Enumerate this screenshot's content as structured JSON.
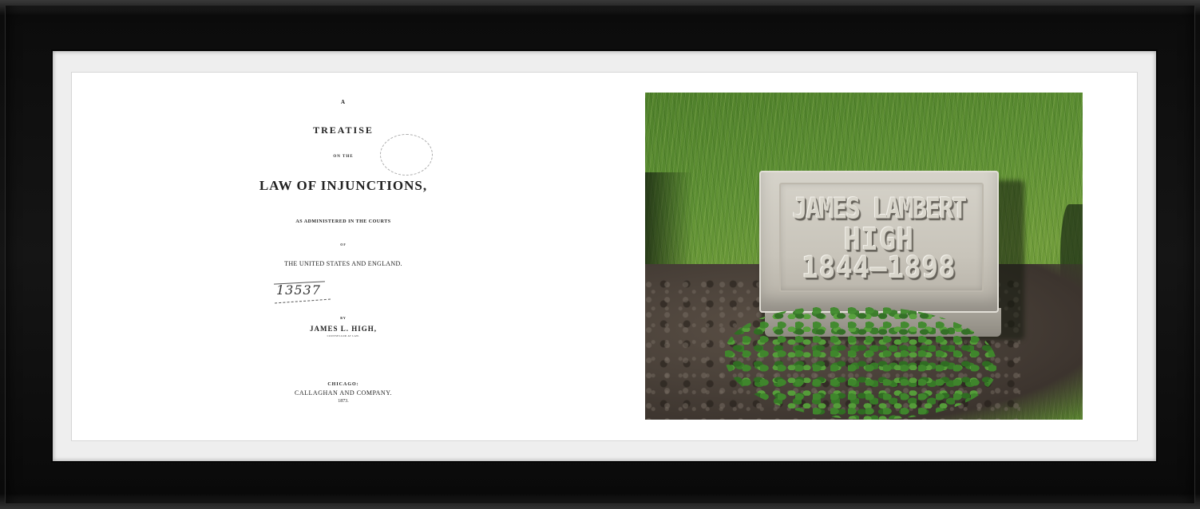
{
  "title_page": {
    "line_a": "A",
    "title": "TREATISE",
    "on_the": "ON THE",
    "subject": "LAW OF INJUNCTIONS,",
    "administered": "AS ADMINISTERED IN THE COURTS",
    "of": "OF",
    "jurisdictions": "THE UNITED STATES AND ENGLAND.",
    "stamp_number": "13537",
    "by": "BY",
    "author": "JAMES L. HIGH,",
    "author_role": "COUNSELLOR AT LAW.",
    "city": "CHICAGO:",
    "publisher": "CALLAGHAN AND COMPANY.",
    "year": "1873."
  },
  "gravestone": {
    "line1": "JAMES LAMBERT",
    "line2": "HIGH",
    "line3": "1844–1898"
  }
}
